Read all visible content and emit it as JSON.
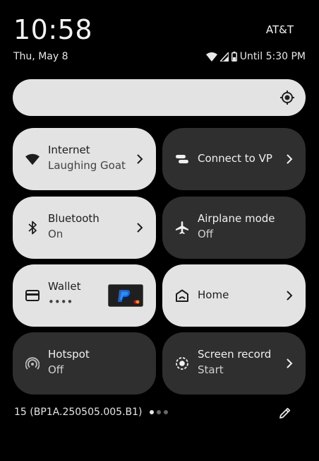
{
  "status_bar": {
    "time": "10:58",
    "carrier": "AT&T",
    "date": "Thu, May 8",
    "battery_text": "Until 5:30 PM"
  },
  "brightness": {
    "level": 1.0
  },
  "tiles": [
    {
      "title": "Internet",
      "subtitle": "Laughing Goat",
      "state": "on",
      "icon": "wifi-icon",
      "has_chevron": true
    },
    {
      "title": "Connect to VP",
      "subtitle": "",
      "state": "off",
      "icon": "vpn-icon",
      "has_chevron": true
    },
    {
      "title": "Bluetooth",
      "subtitle": "On",
      "state": "on",
      "icon": "bluetooth-icon",
      "has_chevron": true
    },
    {
      "title": "Airplane mode",
      "subtitle": "Off",
      "state": "off",
      "icon": "airplane-icon",
      "has_chevron": false
    },
    {
      "title": "Wallet",
      "subtitle": "••••",
      "state": "on",
      "icon": "wallet-icon",
      "has_chevron": false
    },
    {
      "title": "Home",
      "subtitle": "",
      "state": "on",
      "icon": "home-icon",
      "has_chevron": true
    },
    {
      "title": "Hotspot",
      "subtitle": "Off",
      "state": "off",
      "icon": "hotspot-icon",
      "has_chevron": false
    },
    {
      "title": "Screen record",
      "subtitle": "Start",
      "state": "off",
      "icon": "screen-record-icon",
      "has_chevron": true
    }
  ],
  "footer": {
    "build": "15 (BP1A.250505.005.B1)",
    "page_count": 3,
    "active_page": 1
  },
  "colors": {
    "background": "#000000",
    "tile_on": "#e3e3e3",
    "tile_off": "#2f2f2f"
  }
}
